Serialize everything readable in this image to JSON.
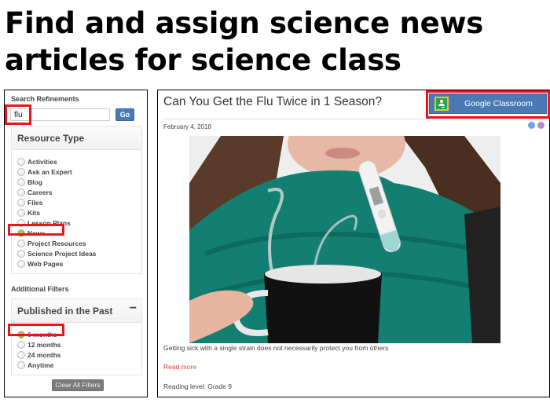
{
  "headline": {
    "line1": "Find and assign science news",
    "line2": "articles for science class"
  },
  "sidebar": {
    "search_label": "Search Refinements",
    "search_value": "flu",
    "go_label": "Go",
    "resource_type": {
      "title": "Resource Type",
      "options": [
        {
          "label": "Activities",
          "selected": false
        },
        {
          "label": "Ask an Expert",
          "selected": false
        },
        {
          "label": "Blog",
          "selected": false
        },
        {
          "label": "Careers",
          "selected": false
        },
        {
          "label": "Files",
          "selected": false
        },
        {
          "label": "Kits",
          "selected": false
        },
        {
          "label": "Lesson Plans",
          "selected": false
        },
        {
          "label": "News",
          "selected": true
        },
        {
          "label": "Project Resources",
          "selected": false
        },
        {
          "label": "Science Project Ideas",
          "selected": false
        },
        {
          "label": "Web Pages",
          "selected": false
        }
      ]
    },
    "additional_filters_label": "Additional Filters",
    "published": {
      "title": "Published in the Past",
      "toggle": "−",
      "options": [
        {
          "label": "6 months",
          "selected": true
        },
        {
          "label": "12 months",
          "selected": false
        },
        {
          "label": "24 months",
          "selected": false
        },
        {
          "label": "Anytime",
          "selected": false
        }
      ]
    },
    "clear_label": "Clear All Filters"
  },
  "article": {
    "title": "Can You Get the Flu Twice in 1 Season?",
    "date": "February 4, 2018",
    "google_classroom_label": "Google Classroom",
    "image_alt": "Woman with scarf, thermometer in mouth, holding steaming mug",
    "summary": "Getting sick with a single strain does not necessarily protect you from others",
    "read_more": "Read more",
    "reading_level": "Reading level: Grade 9"
  },
  "colors": {
    "highlight": "#e8161b",
    "selected_radio": "#6cbf2a",
    "button_blue": "#4b79b4",
    "read_more": "#e53b2c"
  }
}
